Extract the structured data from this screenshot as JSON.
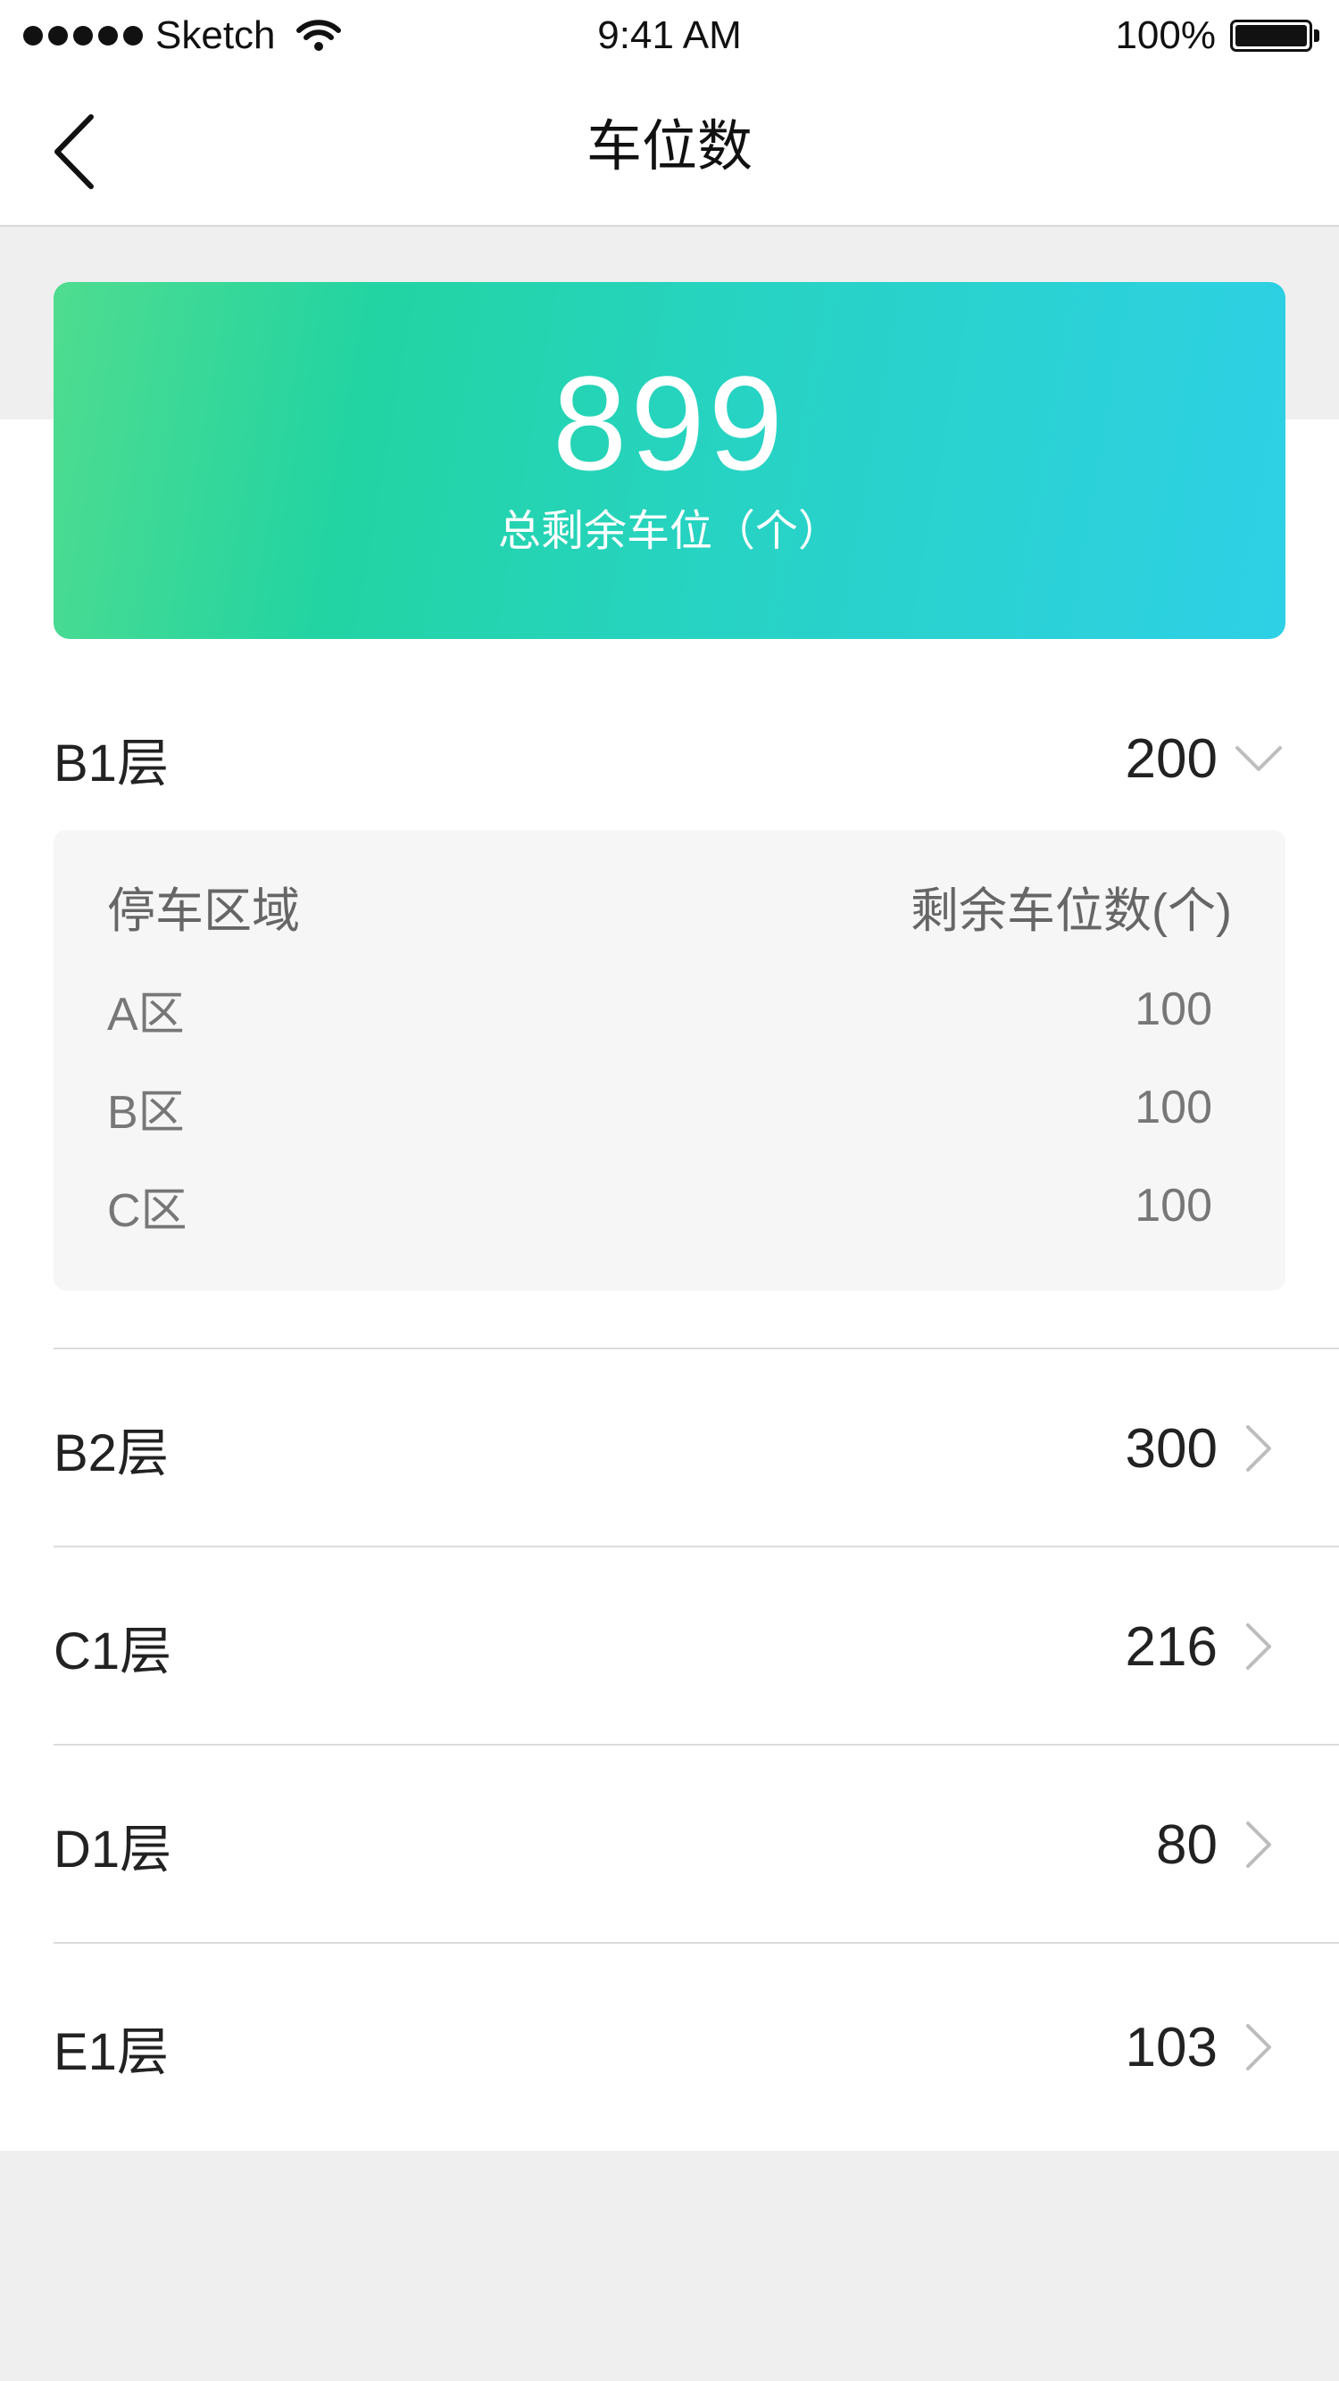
{
  "status_bar": {
    "carrier": "Sketch",
    "time": "9:41 AM",
    "battery": "100%"
  },
  "nav": {
    "title": "车位数",
    "back_icon": "chevron-left-icon"
  },
  "summary": {
    "total": "899",
    "label": "总剩余车位（个）",
    "gradient_colors": [
      "#4fdc8f",
      "#22d4a2",
      "#2ed0e6"
    ]
  },
  "floors": [
    {
      "name": "B1层",
      "count": "200",
      "expanded": true
    },
    {
      "name": "B2层",
      "count": "300",
      "expanded": false
    },
    {
      "name": "C1层",
      "count": "216",
      "expanded": false
    },
    {
      "name": "D1层",
      "count": "80",
      "expanded": false
    },
    {
      "name": "E1层",
      "count": "103",
      "expanded": false
    }
  ],
  "zones": {
    "header_area": "停车区域",
    "header_count": "剩余车位数(个)",
    "rows": [
      {
        "area": "A区",
        "count": "100"
      },
      {
        "area": "B区",
        "count": "100"
      },
      {
        "area": "C区",
        "count": "100"
      }
    ]
  }
}
